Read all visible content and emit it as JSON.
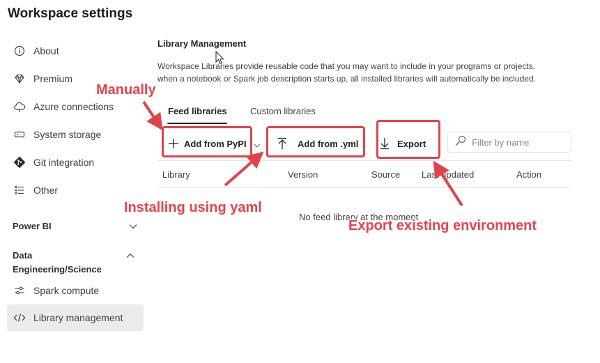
{
  "page_title": "Workspace settings",
  "sidebar": {
    "items": [
      {
        "label": "About",
        "icon": "info-icon"
      },
      {
        "label": "Premium",
        "icon": "diamond-icon"
      },
      {
        "label": "Azure connections",
        "icon": "cloud-icon"
      },
      {
        "label": "System storage",
        "icon": "storage-icon"
      },
      {
        "label": "Git integration",
        "icon": "git-icon"
      },
      {
        "label": "Other",
        "icon": "list-icon"
      }
    ],
    "sections": [
      {
        "label": "Power BI",
        "expanded": false
      },
      {
        "label": "Data Engineering/Science",
        "expanded": true
      }
    ],
    "sub_items": [
      {
        "label": "Spark compute",
        "icon": "sliders-icon"
      },
      {
        "label": "Library management",
        "icon": "code-icon",
        "active": true
      }
    ]
  },
  "main": {
    "title": "Library Management",
    "description_line1": "Workspace Libraries provide reusable code that you may want to include in your programs or projects.",
    "description_line2": "when a notebook or Spark job description starts up, all installed libraries will automatically be included.",
    "tabs": [
      {
        "label": "Feed libraries",
        "active": true
      },
      {
        "label": "Custom libraries",
        "active": false
      }
    ],
    "toolbar": {
      "add_pypi_label": "Add from PyPI",
      "add_yml_label": "Add from .yml",
      "export_label": "Export",
      "filter_placeholder": "Filter by name"
    },
    "table": {
      "columns": [
        "Library",
        "Version",
        "Source",
        "Last updated",
        "Action"
      ],
      "empty_message": "No feed library at the moment"
    }
  },
  "annotations": {
    "manually": "Manually",
    "installing_yaml": "Installing using yaml",
    "export_env": "Export existing environment"
  },
  "colors": {
    "annotation_red": "#e0434b",
    "active_nav_bg": "#ebebeb"
  }
}
